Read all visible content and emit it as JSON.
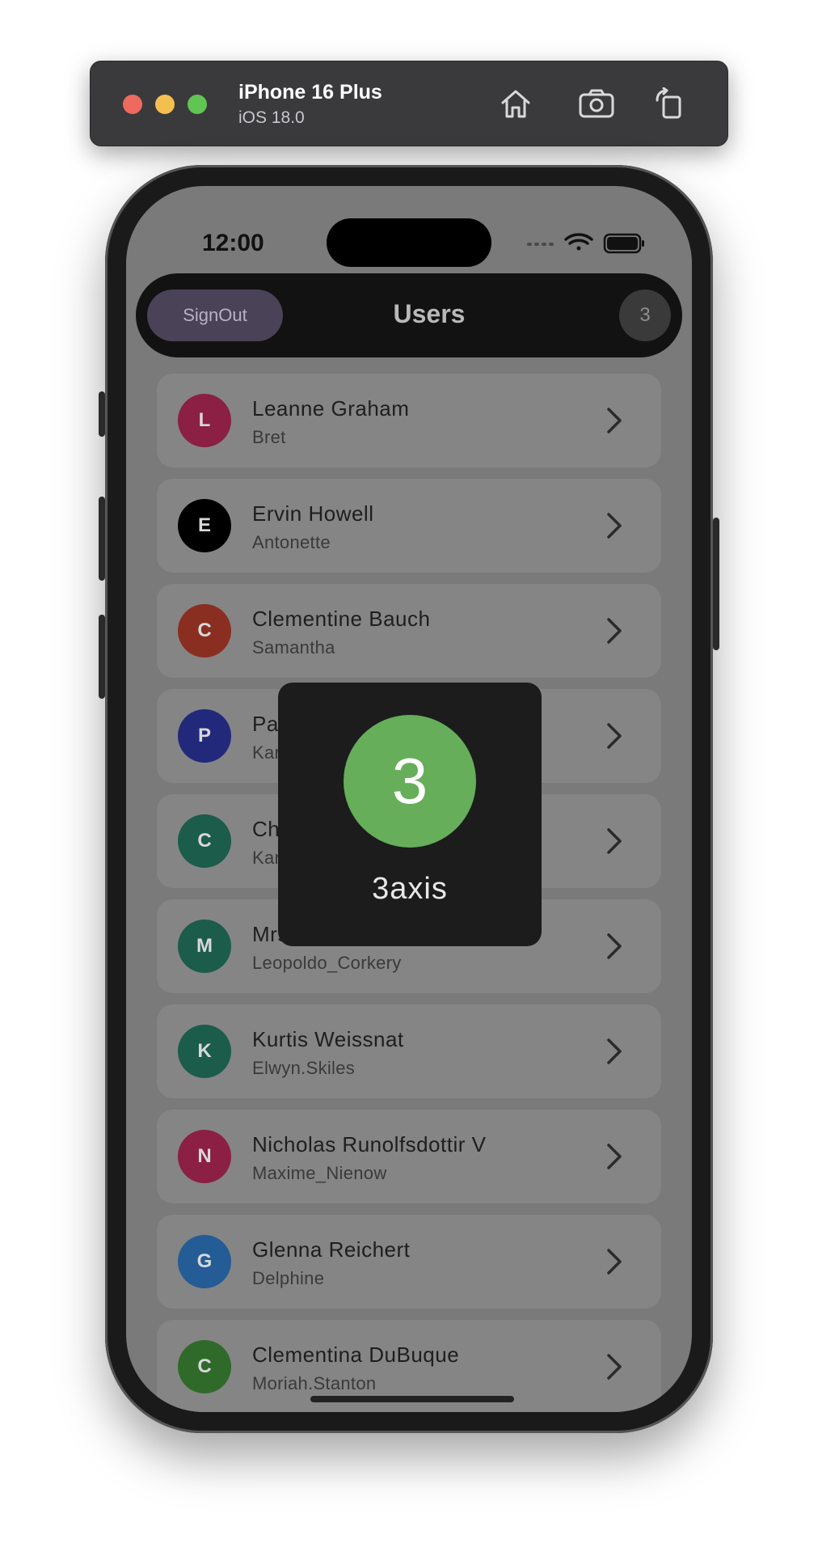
{
  "simulator": {
    "device": "iPhone 16 Plus",
    "os": "iOS 18.0",
    "icons": [
      "home-icon",
      "screenshot-icon",
      "rotate-icon"
    ]
  },
  "status_bar": {
    "time": "12:00"
  },
  "app_bar": {
    "signout_label": "SignOut",
    "title": "Users",
    "count": "3"
  },
  "users": [
    {
      "initial": "L",
      "name": "Leanne Graham",
      "username": "Bret",
      "color": "#8b1f44"
    },
    {
      "initial": "E",
      "name": "Ervin Howell",
      "username": "Antonette",
      "color": "#000000"
    },
    {
      "initial": "C",
      "name": "Clementine Bauch",
      "username": "Samantha",
      "color": "#8a2e22"
    },
    {
      "initial": "P",
      "name": "Patricia Lebsack",
      "username": "Karianne",
      "color": "#22297a"
    },
    {
      "initial": "C",
      "name": "Chelsey Dietrich",
      "username": "Kamren",
      "color": "#1b5c4a"
    },
    {
      "initial": "M",
      "name": "Mrs. Dennis Schulist",
      "username": "Leopoldo_Corkery",
      "color": "#1b5c4a"
    },
    {
      "initial": "K",
      "name": "Kurtis Weissnat",
      "username": "Elwyn.Skiles",
      "color": "#1b5c4a"
    },
    {
      "initial": "N",
      "name": "Nicholas Runolfsdottir V",
      "username": "Maxime_Nienow",
      "color": "#8b1f44"
    },
    {
      "initial": "G",
      "name": "Glenna Reichert",
      "username": "Delphine",
      "color": "#245c95"
    },
    {
      "initial": "C",
      "name": "Clementina DuBuque",
      "username": "Moriah.Stanton",
      "color": "#2f6a2a"
    }
  ],
  "overlay": {
    "number": "3",
    "label": "3axis",
    "circle_color": "#66ae5a"
  }
}
